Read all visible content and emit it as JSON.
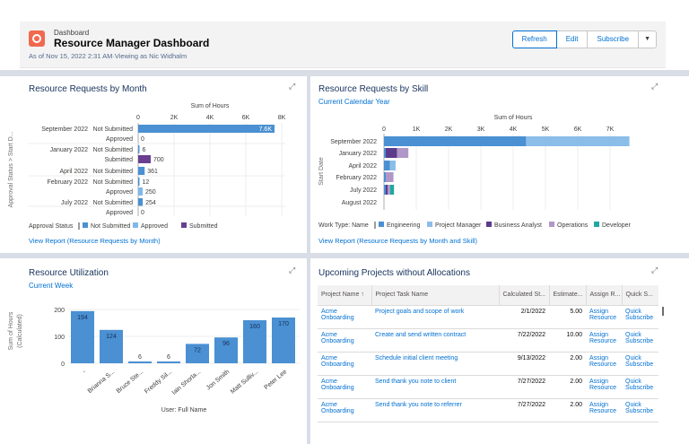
{
  "header": {
    "small": "Dashboard",
    "title": "Resource Manager Dashboard",
    "subtitle": "As of Nov 15, 2022 2:31 AM·Viewing as Nic Widhalm",
    "buttons": {
      "refresh": "Refresh",
      "edit": "Edit",
      "subscribe": "Subscribe"
    },
    "dropdown_icon": "chevron-down-icon"
  },
  "colors": {
    "not_submitted": "#4a90d2",
    "approved": "#7fb8ea",
    "submitted": "#6a3f8f",
    "engineering": "#4a90d2",
    "project_manager": "#8bbde9",
    "business_analyst": "#5c3b8c",
    "operations": "#b197c7",
    "developer": "#1fa8a0",
    "utilization_bar": "#4a90d2"
  },
  "panel1": {
    "title": "Resource Requests by Month",
    "expand_icon": "expand-icon",
    "footer_link": "View Report (Resource Requests by Month)",
    "chart_data": {
      "type": "bar",
      "orientation": "horizontal",
      "title": "Sum of Hours",
      "ylabel": "Approval Status > Start D...",
      "xlim": [
        0,
        8000
      ],
      "xticks": [
        "0",
        "2K",
        "4K",
        "6K",
        "8K"
      ],
      "legend_title": "Approval Status",
      "legend": [
        "Not Submitted",
        "Approved",
        "Submitted"
      ],
      "rows": [
        {
          "date": "September 2022",
          "status": "Not Submitted",
          "value": 7600,
          "label": "7.6K",
          "series": "not_submitted"
        },
        {
          "date": "",
          "status": "Approved",
          "value": 0,
          "label": "0",
          "series": "approved"
        },
        {
          "date": "January 2022",
          "status": "Not Submitted",
          "value": 6,
          "label": "6",
          "series": "not_submitted"
        },
        {
          "date": "",
          "status": "Submitted",
          "value": 700,
          "label": "700",
          "series": "submitted"
        },
        {
          "date": "April 2022",
          "status": "Not Submitted",
          "value": 361,
          "label": "361",
          "series": "not_submitted"
        },
        {
          "date": "February 2022",
          "status": "Not Submitted",
          "value": 12,
          "label": "12",
          "series": "not_submitted"
        },
        {
          "date": "",
          "status": "Approved",
          "value": 250,
          "label": "250",
          "series": "approved"
        },
        {
          "date": "July 2022",
          "status": "Not Submitted",
          "value": 254,
          "label": "254",
          "series": "not_submitted"
        },
        {
          "date": "",
          "status": "Approved",
          "value": 0,
          "label": "0",
          "series": "approved"
        }
      ]
    }
  },
  "panel2": {
    "title": "Resource Requests by Skill",
    "subtitle": "Current Calendar Year",
    "expand_icon": "expand-icon",
    "footer_link": "View Report (Resource Requests by Month and Skill)",
    "chart_data": {
      "type": "bar",
      "orientation": "horizontal-stacked",
      "title": "Sum of Hours",
      "ylabel": "Start Date",
      "xlim": [
        0,
        8000
      ],
      "xticks": [
        "0",
        "1K",
        "2K",
        "3K",
        "4K",
        "5K",
        "6K",
        "7K"
      ],
      "categories": [
        "September 2022",
        "January 2022",
        "April 2022",
        "February 2022",
        "July 2022",
        "August 2022"
      ],
      "legend_title": "Work Type: Name",
      "series": [
        {
          "name": "Engineering",
          "key": "engineering",
          "values": [
            4400,
            6,
            180,
            12,
            40,
            0
          ]
        },
        {
          "name": "Project Manager",
          "key": "project_manager",
          "values": [
            3200,
            0,
            180,
            0,
            0,
            0
          ]
        },
        {
          "name": "Business Analyst",
          "key": "business_analyst",
          "values": [
            0,
            350,
            0,
            0,
            40,
            0
          ]
        },
        {
          "name": "Operations",
          "key": "operations",
          "values": [
            0,
            350,
            0,
            238,
            80,
            0
          ]
        },
        {
          "name": "Developer",
          "key": "developer",
          "values": [
            0,
            0,
            0,
            0,
            120,
            0
          ]
        }
      ]
    }
  },
  "panel3": {
    "title": "Resource Utilization",
    "subtitle": "Current Week",
    "expand_icon": "expand-icon",
    "chart_data": {
      "type": "bar",
      "ylabel": "Sum of Hours (Calculated)",
      "xlabel": "User: Full Name",
      "ylim": [
        0,
        200
      ],
      "yticks": [
        "0",
        "100",
        "200"
      ],
      "categories": [
        "-",
        "Brianna S...",
        "Bruce Ste...",
        "Freddy Sil...",
        "Iain Shorla...",
        "Jon Smith",
        "Matt Sulliv...",
        "Peter Lee"
      ],
      "values": [
        194,
        124,
        6,
        6,
        72,
        96,
        160,
        170
      ]
    }
  },
  "panel4": {
    "title": "Upcoming Projects without Allocations",
    "expand_icon": "expand-icon",
    "sort_icon": "sort-arrow-icon",
    "columns": [
      "Project Name",
      "Project Task Name",
      "Calculated St...",
      "Estimate...",
      "Assign R...",
      "Quick S..."
    ],
    "rows": [
      {
        "project": "Acme Onboarding",
        "task": "Project goals and scope of work",
        "start": "2/1/2022",
        "estimate": "5.00",
        "assign": "Assign Resource",
        "quick": "Quick Subscribe"
      },
      {
        "project": "Acme Onboarding",
        "task": "Create and send written contract",
        "start": "7/22/2022",
        "estimate": "10.00",
        "assign": "Assign Resource",
        "quick": "Quick Subscribe"
      },
      {
        "project": "Acme Onboarding",
        "task": "Schedule initial client meeting",
        "start": "9/13/2022",
        "estimate": "2.00",
        "assign": "Assign Resource",
        "quick": "Quick Subscribe"
      },
      {
        "project": "Acme Onboarding",
        "task": "Send thank you note to client",
        "start": "7/27/2022",
        "estimate": "2.00",
        "assign": "Assign Resource",
        "quick": "Quick Subscribe"
      },
      {
        "project": "Acme Onboarding",
        "task": "Send thank you note to referrer",
        "start": "7/27/2022",
        "estimate": "2.00",
        "assign": "Assign Resource",
        "quick": "Quick Subscribe"
      }
    ]
  }
}
